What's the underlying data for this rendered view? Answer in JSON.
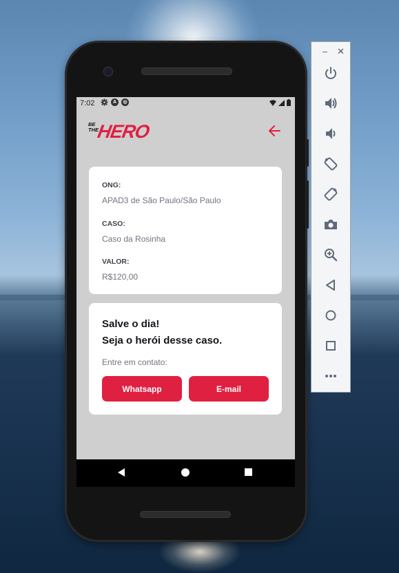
{
  "status_bar": {
    "time": "7:02"
  },
  "app": {
    "logo_small": "BE THE",
    "logo_big": "HERO",
    "accent_color": "#e02041"
  },
  "incident": {
    "ong_label": "ONG:",
    "ong_value": "APAD3 de São Paulo/São Paulo",
    "caso_label": "CASO:",
    "caso_value": "Caso da Rosinha",
    "valor_label": "VALOR:",
    "valor_value": "R$120,00"
  },
  "contact": {
    "title_line1": "Salve o dia!",
    "title_line2": "Seja o herói desse caso.",
    "subtitle": "Entre em contato:",
    "whatsapp_label": "Whatsapp",
    "email_label": "E-mail"
  },
  "emulator_toolbar": {
    "minimize": "–",
    "close": "✕",
    "buttons": [
      "power-icon",
      "volume-up-icon",
      "volume-down-icon",
      "rotate-left-icon",
      "rotate-right-icon",
      "camera-icon",
      "zoom-icon",
      "back-icon",
      "home-icon",
      "overview-icon",
      "more-icon"
    ]
  }
}
